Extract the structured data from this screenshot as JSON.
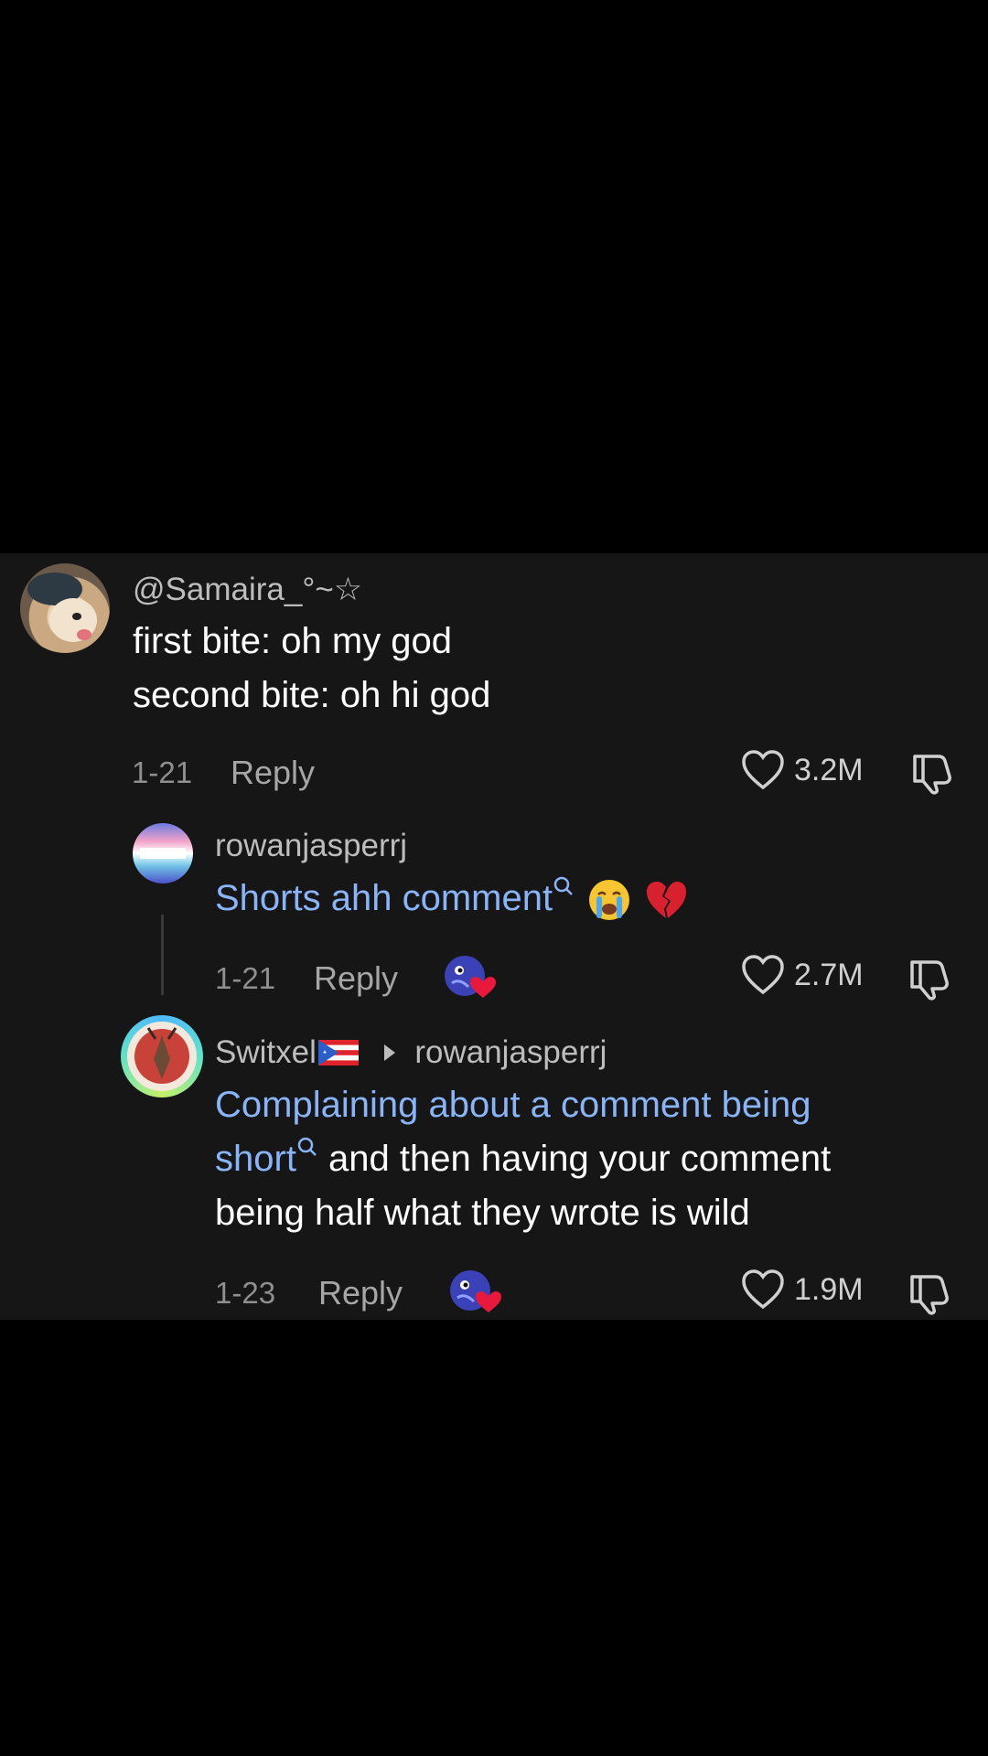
{
  "comments": [
    {
      "username": "@Samaira_°~☆",
      "lines": [
        "first bite: oh my god",
        "second bite: oh hi god"
      ],
      "date": "1-21",
      "reply_label": "Reply",
      "likes": "3.2M"
    },
    {
      "username": "rowanjasperrj",
      "link_text": "Shorts ahh comment",
      "date": "1-21",
      "reply_label": "Reply",
      "likes": "2.7M"
    },
    {
      "username": "Switxel",
      "reply_to": "rowanjasperrj",
      "link_text_1": "Complaining about a comment being",
      "link_text_2": "short",
      "text_after": " and then having your comment",
      "text_line3": "being half what they wrote is wild",
      "date": "1-23",
      "reply_label": "Reply",
      "likes": "1.9M"
    }
  ],
  "icons": {
    "like": "heart-outline-icon",
    "dislike": "thumbs-down-icon",
    "search": "search-icon",
    "creator_liked": "creator-liked-badge-icon"
  },
  "colors": {
    "link": "#8ab4f8",
    "panel": "#161616",
    "heart": "#e8193c"
  }
}
